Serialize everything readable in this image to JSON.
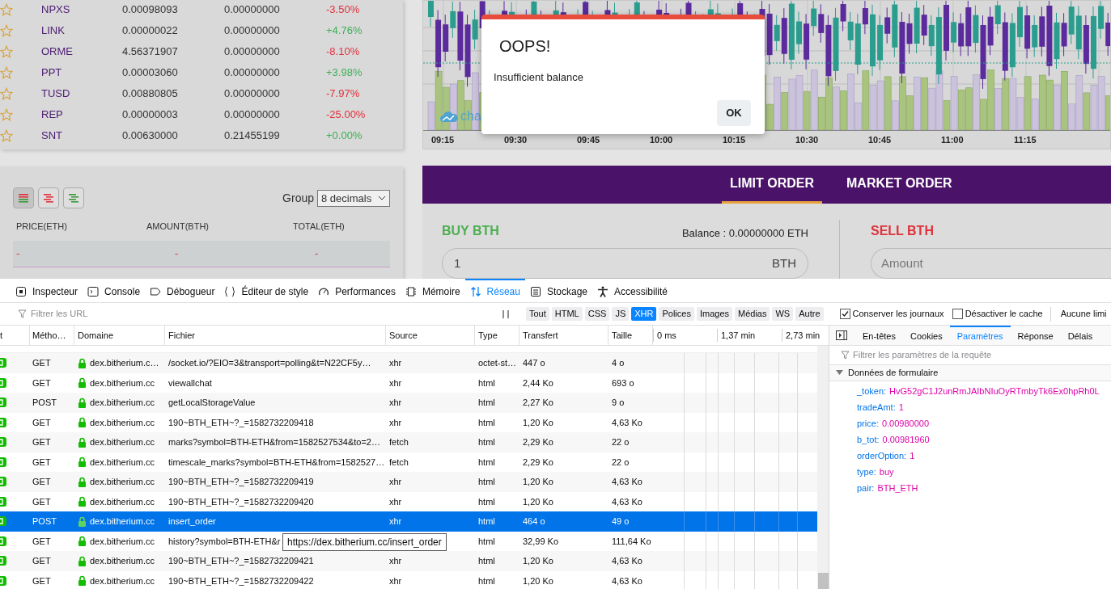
{
  "markets": [
    {
      "symbol": "NPXS",
      "price": "0.00098093",
      "volume": "0.00000000",
      "change": "-3.50%",
      "color": "#e0323c",
      "favorite": false
    },
    {
      "symbol": "LINK",
      "price": "0.00000022",
      "volume": "0.00000000",
      "change": "+4.76%",
      "color": "#3cb054",
      "favorite": false
    },
    {
      "symbol": "ORME",
      "price": "4.56371907",
      "volume": "0.00000000",
      "change": "-8.10%",
      "color": "#e0323c",
      "favorite": false
    },
    {
      "symbol": "PPT",
      "price": "0.00003060",
      "volume": "0.00000000",
      "change": "+3.98%",
      "color": "#3cb054",
      "favorite": false
    },
    {
      "symbol": "TUSD",
      "price": "0.00880805",
      "volume": "0.00000000",
      "change": "-7.97%",
      "color": "#e0323c",
      "favorite": false
    },
    {
      "symbol": "REP",
      "price": "0.00000003",
      "volume": "0.00000000",
      "change": "-25.00%",
      "color": "#e0323c",
      "favorite": false
    },
    {
      "symbol": "SNT",
      "price": "0.00630000",
      "volume": "0.21455199",
      "change": "+0.00%",
      "color": "#3cb054",
      "favorite": false
    }
  ],
  "chart": {
    "logo_text": "cha",
    "time_labels": [
      "09:15",
      "09:30",
      "09:45",
      "10:00",
      "10:15",
      "10:30",
      "10:45",
      "11:00",
      "11:15"
    ]
  },
  "dialog": {
    "title": "OOPS!",
    "message": "Insufficient balance",
    "button": "OK"
  },
  "order_book": {
    "view_buttons": [
      {
        "kind": "both",
        "selected": true
      },
      {
        "kind": "sell",
        "selected": false
      },
      {
        "kind": "buy",
        "selected": false
      }
    ],
    "group_label": "Group",
    "group_value": "8 decimals",
    "columns": [
      "PRICE(ETH)",
      "AMOUNT(BTH)",
      "TOTAL(ETH)"
    ],
    "rows": [
      [
        "-",
        "-",
        "-"
      ]
    ]
  },
  "order_form": {
    "tabs": [
      {
        "label": "LIMIT ORDER",
        "selected": true
      },
      {
        "label": "MARKET ORDER",
        "selected": false
      }
    ],
    "buy": {
      "title": "BUY BTH",
      "balance": "Balance : 0.00000000 ETH",
      "amount_value": "1",
      "unit": "BTH"
    },
    "sell": {
      "title": "SELL BTH",
      "amount_placeholder": "Amount"
    }
  },
  "devtools": {
    "tabs": [
      {
        "label": "Inspecteur",
        "kind": "inspector",
        "selected": false
      },
      {
        "label": "Console",
        "kind": "console",
        "selected": false
      },
      {
        "label": "Débogueur",
        "kind": "debugger",
        "selected": false
      },
      {
        "label": "Éditeur de style",
        "kind": "style",
        "selected": false
      },
      {
        "label": "Performances",
        "kind": "performance",
        "selected": false
      },
      {
        "label": "Mémoire",
        "kind": "memory",
        "selected": false
      },
      {
        "label": "Réseau",
        "kind": "network",
        "selected": true
      },
      {
        "label": "Stockage",
        "kind": "storage",
        "selected": false
      },
      {
        "label": "Accessibilité",
        "kind": "accessibility",
        "selected": false
      }
    ],
    "filter_placeholder": "Filtrer les URL",
    "type_filters": [
      {
        "label": "Tout",
        "selected": false
      },
      {
        "label": "HTML",
        "selected": false
      },
      {
        "label": "CSS",
        "selected": false
      },
      {
        "label": "JS",
        "selected": false
      },
      {
        "label": "XHR",
        "selected": true
      },
      {
        "label": "Polices",
        "selected": false
      },
      {
        "label": "Images",
        "selected": false
      },
      {
        "label": "Médias",
        "selected": false
      },
      {
        "label": "WS",
        "selected": false
      },
      {
        "label": "Autre",
        "selected": false
      }
    ],
    "options": [
      {
        "label": "Conserver les journaux",
        "checked": true
      },
      {
        "label": "Désactiver le cache",
        "checked": false
      }
    ],
    "throttle": "Aucune limi",
    "network": {
      "columns": [
        "t",
        "Métho…",
        "Domaine",
        "Fichier",
        "Source",
        "Type",
        "Transfert",
        "Taille"
      ],
      "timeline_ticks": [
        "0 ms",
        "1,37 min",
        "2,73 min"
      ],
      "rows": [
        {
          "method": "GET",
          "domain": "dex.bitherium.c…",
          "file": "/socket.io/?EIO=3&transport=polling&t=N22CF5y…",
          "source": "xhr",
          "type": "octet-st…",
          "transfer": "447 o",
          "size": "4 o",
          "selected": false
        },
        {
          "method": "GET",
          "domain": "dex.bitherium.cc",
          "file": "viewallchat",
          "source": "xhr",
          "type": "html",
          "transfer": "2,44 Ko",
          "size": "693 o",
          "selected": false
        },
        {
          "method": "POST",
          "domain": "dex.bitherium.cc",
          "file": "getLocalStorageValue",
          "source": "xhr",
          "type": "html",
          "transfer": "2,27 Ko",
          "size": "9 o",
          "selected": false
        },
        {
          "method": "GET",
          "domain": "dex.bitherium.cc",
          "file": "190~BTH_ETH~?_=1582732209418",
          "source": "xhr",
          "type": "html",
          "transfer": "1,20 Ko",
          "size": "4,63 Ko",
          "selected": false
        },
        {
          "method": "GET",
          "domain": "dex.bitherium.cc",
          "file": "marks?symbol=BTH-ETH&from=1582527534&to=2…",
          "source": "fetch",
          "type": "html",
          "transfer": "2,29 Ko",
          "size": "22 o",
          "selected": false
        },
        {
          "method": "GET",
          "domain": "dex.bitherium.cc",
          "file": "timescale_marks?symbol=BTH-ETH&from=1582527…",
          "source": "fetch",
          "type": "html",
          "transfer": "2,29 Ko",
          "size": "22 o",
          "selected": false
        },
        {
          "method": "GET",
          "domain": "dex.bitherium.cc",
          "file": "190~BTH_ETH~?_=1582732209419",
          "source": "xhr",
          "type": "html",
          "transfer": "1,20 Ko",
          "size": "4,63 Ko",
          "selected": false
        },
        {
          "method": "GET",
          "domain": "dex.bitherium.cc",
          "file": "190~BTH_ETH~?_=1582732209420",
          "source": "xhr",
          "type": "html",
          "transfer": "1,20 Ko",
          "size": "4,63 Ko",
          "selected": false
        },
        {
          "method": "POST",
          "domain": "dex.bitherium.cc",
          "file": "insert_order",
          "source": "xhr",
          "type": "html",
          "transfer": "464 o",
          "size": "49 o",
          "selected": true
        },
        {
          "method": "GET",
          "domain": "dex.bitherium.cc",
          "file": "history?symbol=BTH-ETH&r",
          "type": "html",
          "transfer": "32,99 Ko",
          "size": "111,64 Ko",
          "selected": false
        },
        {
          "method": "GET",
          "domain": "dex.bitherium.cc",
          "file": "190~BTH_ETH~?_=1582732209421",
          "source": "xhr",
          "type": "html",
          "transfer": "1,20 Ko",
          "size": "4,63 Ko",
          "selected": false
        },
        {
          "method": "GET",
          "domain": "dex.bitherium.cc",
          "file": "190~BTH_ETH~?_=1582732209422",
          "source": "xhr",
          "type": "html",
          "transfer": "1,20 Ko",
          "size": "4,63 Ko",
          "selected": false
        }
      ],
      "tooltip": "https://dex.bitherium.cc/insert_order"
    },
    "details": {
      "tabs": [
        {
          "label": "En-têtes",
          "selected": false
        },
        {
          "label": "Cookies",
          "selected": false
        },
        {
          "label": "Paramètres",
          "selected": true
        },
        {
          "label": "Réponse",
          "selected": false
        },
        {
          "label": "Délais",
          "selected": false
        }
      ],
      "filter_placeholder": "Filtrer les paramètres de la requête",
      "section": {
        "title": "Données de formulaire",
        "expanded": true,
        "params": [
          {
            "key": "_token:",
            "value": "HvG52gC1J2unRmJAIbNIuOyRTmbyTk6Ex0hpRh0L"
          },
          {
            "key": "tradeAmt:",
            "value": "1"
          },
          {
            "key": "price:",
            "value": "0.00980000"
          },
          {
            "key": "b_tot:",
            "value": "0.00981960"
          },
          {
            "key": "orderOption:",
            "value": "1"
          },
          {
            "key": "type:",
            "value": "buy"
          },
          {
            "key": "pair:",
            "value": "BTH_ETH"
          }
        ]
      }
    }
  }
}
